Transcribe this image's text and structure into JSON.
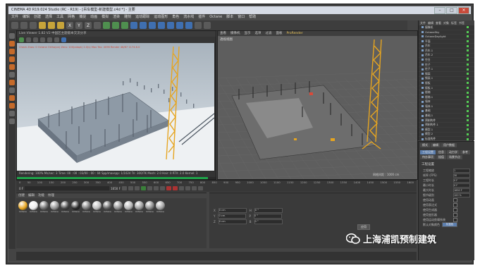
{
  "window": {
    "title": "CINEMA 4D R19.024 Studio (RC - R19) - [吊车模型-新建模型.c4d *] - 主要"
  },
  "menu": [
    "文件",
    "编辑",
    "创建",
    "选择",
    "工具",
    "网格",
    "捕捉",
    "动画",
    "模拟",
    "渲染",
    "雕刻",
    "运动跟踪",
    "运动图形",
    "角色",
    "流水线",
    "插件",
    "Octane",
    "脚本",
    "窗口",
    "帮助"
  ],
  "toolbar_icons": [
    "undo-icon",
    "redo-icon",
    "select-icon",
    "move-icon",
    "scale-icon",
    "rotate-icon",
    "axis-x-icon",
    "axis-y-icon",
    "axis-z-icon",
    "coord-icon",
    "render-region-icon",
    "render-view-icon",
    "render-settings-icon",
    "cube-icon",
    "pen-icon",
    "subdivide-icon",
    "array-icon",
    "boole-icon",
    "deformer-icon",
    "floor-icon",
    "camera-icon",
    "light-icon"
  ],
  "picture_viewer": {
    "header": "Live Viewer 1.82  V2 中国区主题版本交流分享",
    "status_line": "Check Znav: 0 Octane Ortho(on) Zero: 100(adapt) 2.0(s) Max Tex: 4096 Render 48/87 1174.6.0",
    "render_info": "Rendering: 100%   Ms/sec: 3   Time: 00 : 00 : 03/00 : 00 : 04   Spp/maxspp: 1/1024   Tri: 300/7K   Mesh: 2.0   Hair: 0   RTX: 2.0   Kernel: 1",
    "progress": 0.96
  },
  "viewport": {
    "menu": [
      "查看",
      "摄像机",
      "显示",
      "选项",
      "过滤",
      "面板",
      "ProRender"
    ],
    "active_menu": "ProRender",
    "label": "透视视图",
    "grid_label": "网格间距 : 1000 cm"
  },
  "timeline": {
    "ticks": [
      "0",
      "50",
      "100",
      "150",
      "200",
      "250",
      "300",
      "350",
      "400",
      "450",
      "500",
      "550",
      "600",
      "650",
      "700",
      "750",
      "800",
      "850",
      "900",
      "950",
      "1000",
      "1050",
      "1100",
      "1150",
      "1200",
      "1250",
      "1300",
      "1350",
      "1400",
      "1450",
      "1500",
      "1550",
      "1600"
    ],
    "current_frame": "0 F",
    "end_frame": "1650 F"
  },
  "material_manager": {
    "menu": [
      "创建",
      "编辑",
      "功能",
      "纹理"
    ],
    "materials": [
      "Octane",
      "Octane",
      "Octane",
      "Octane",
      "Octane",
      "Octane",
      "Octane",
      "Octane",
      "Octane",
      "Octane",
      "Octane",
      "Octane",
      "Octane",
      "Octane"
    ]
  },
  "coordinates": {
    "labels": [
      "X",
      "Y",
      "Z",
      "H",
      "P",
      "B"
    ],
    "values": [
      "0 cm",
      "0 cm",
      "0 cm",
      "0 °",
      "0 °",
      "0 °"
    ],
    "apply_label": "应用"
  },
  "object_manager": {
    "menu": [
      "文件",
      "编辑",
      "查看",
      "对象",
      "标签",
      "书签"
    ],
    "objects": [
      "摄像机",
      "OctaneSky",
      "OctaneDaylight",
      "平面",
      "吊车",
      "吊车.1",
      "吊车.2",
      "空白",
      "柱子",
      "柱子.1",
      "钢梁",
      "钢梁.1",
      "楼板",
      "楼板.1",
      "楼梯",
      "楼梯.1",
      "墙体",
      "墙体.1",
      "基础",
      "基础.1",
      "预制构件",
      "预制构件.1",
      "模型.1",
      "模型.2",
      "标准构件",
      "地面"
    ]
  },
  "attribute_manager": {
    "tabs": [
      "模式",
      "编辑",
      "用户数据"
    ],
    "subtabs": [
      "工程设置",
      "信息",
      "动力学",
      "参考",
      "待办事项",
      "插值",
      "场景节点"
    ],
    "section": "工程设置",
    "rows": [
      {
        "label": "工程缩放",
        "value": "1"
      },
      {
        "label": "帧率 (FPS)",
        "value": "30"
      },
      {
        "label": "工程时长",
        "value": "0 F"
      },
      {
        "label": "最小时长",
        "value": "0 F"
      },
      {
        "label": "最大时长",
        "value": "1650 F"
      },
      {
        "label": "细节级别",
        "value": "100 %"
      },
      {
        "label": "使用动画",
        "value": ""
      },
      {
        "label": "使用表达式",
        "value": ""
      },
      {
        "label": "使用生成器",
        "value": ""
      },
      {
        "label": "使用变形器",
        "value": ""
      },
      {
        "label": "使用运动剪辑系统",
        "value": ""
      }
    ],
    "default_object_color_label": "默认对象颜色",
    "default_object_color_value": "灰蓝色"
  },
  "watermark": {
    "text": "上海浦凯预制建筑"
  },
  "colors": {
    "crane": "#e6a520",
    "accent": "#5d7fae",
    "progress": "#1fa34a"
  }
}
